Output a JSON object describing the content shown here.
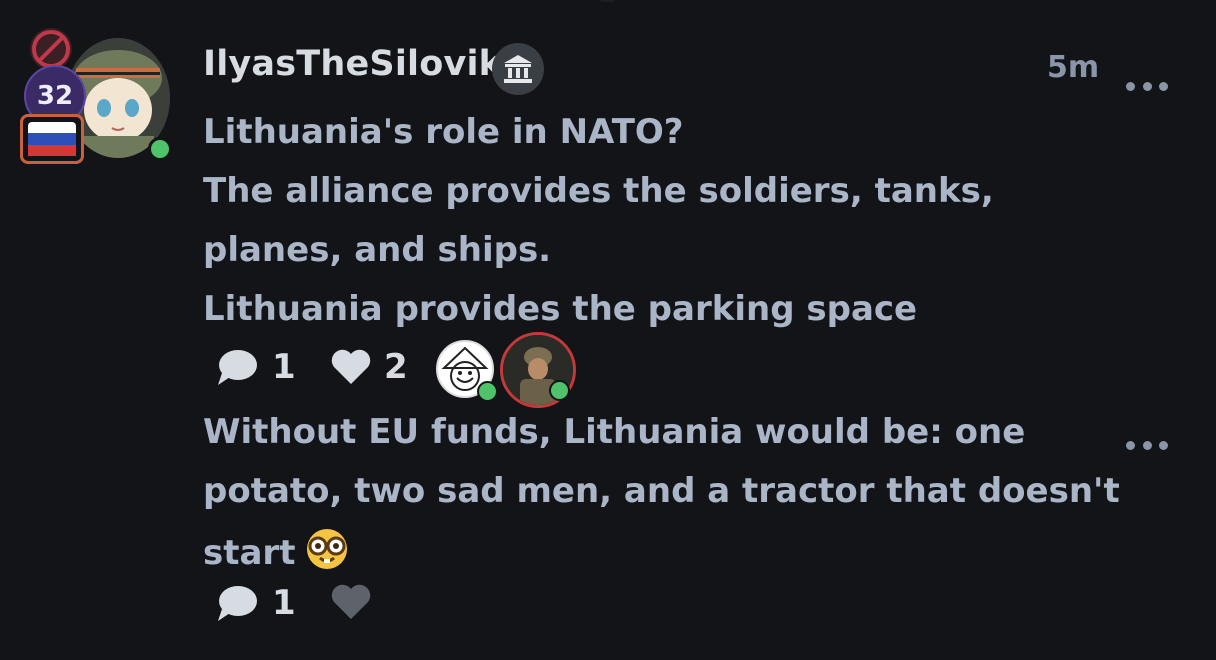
{
  "post1": {
    "author": {
      "username": "IlyasTheSilovik",
      "level": "32",
      "flag": "russia-flag",
      "online": true,
      "verified_icon": "government-building-icon"
    },
    "timestamp": "5m",
    "lines": [
      "Lithuania's role in NATO?",
      "The alliance provides the soldiers, tanks,",
      "planes, and ships.",
      "Lithuania provides the parking space"
    ],
    "comments_count": "1",
    "likes_count": "2",
    "reactors": [
      "reactor-avatar-cartoon",
      "reactor-avatar-soldier"
    ]
  },
  "post2": {
    "lines": [
      "Without EU funds, Lithuania would be: one",
      "potato, two sad men, and a tractor that doesn't",
      "start"
    ],
    "emoji": "nerd-face-emoji",
    "comments_count": "1"
  },
  "colors": {
    "background": "#121418",
    "text": "#aab6c8",
    "username": "#d7dce3",
    "muted": "#8a95a8",
    "online": "#4fc36a",
    "level_badge": "#3a2b67",
    "flag_frame": "#c9623b"
  }
}
